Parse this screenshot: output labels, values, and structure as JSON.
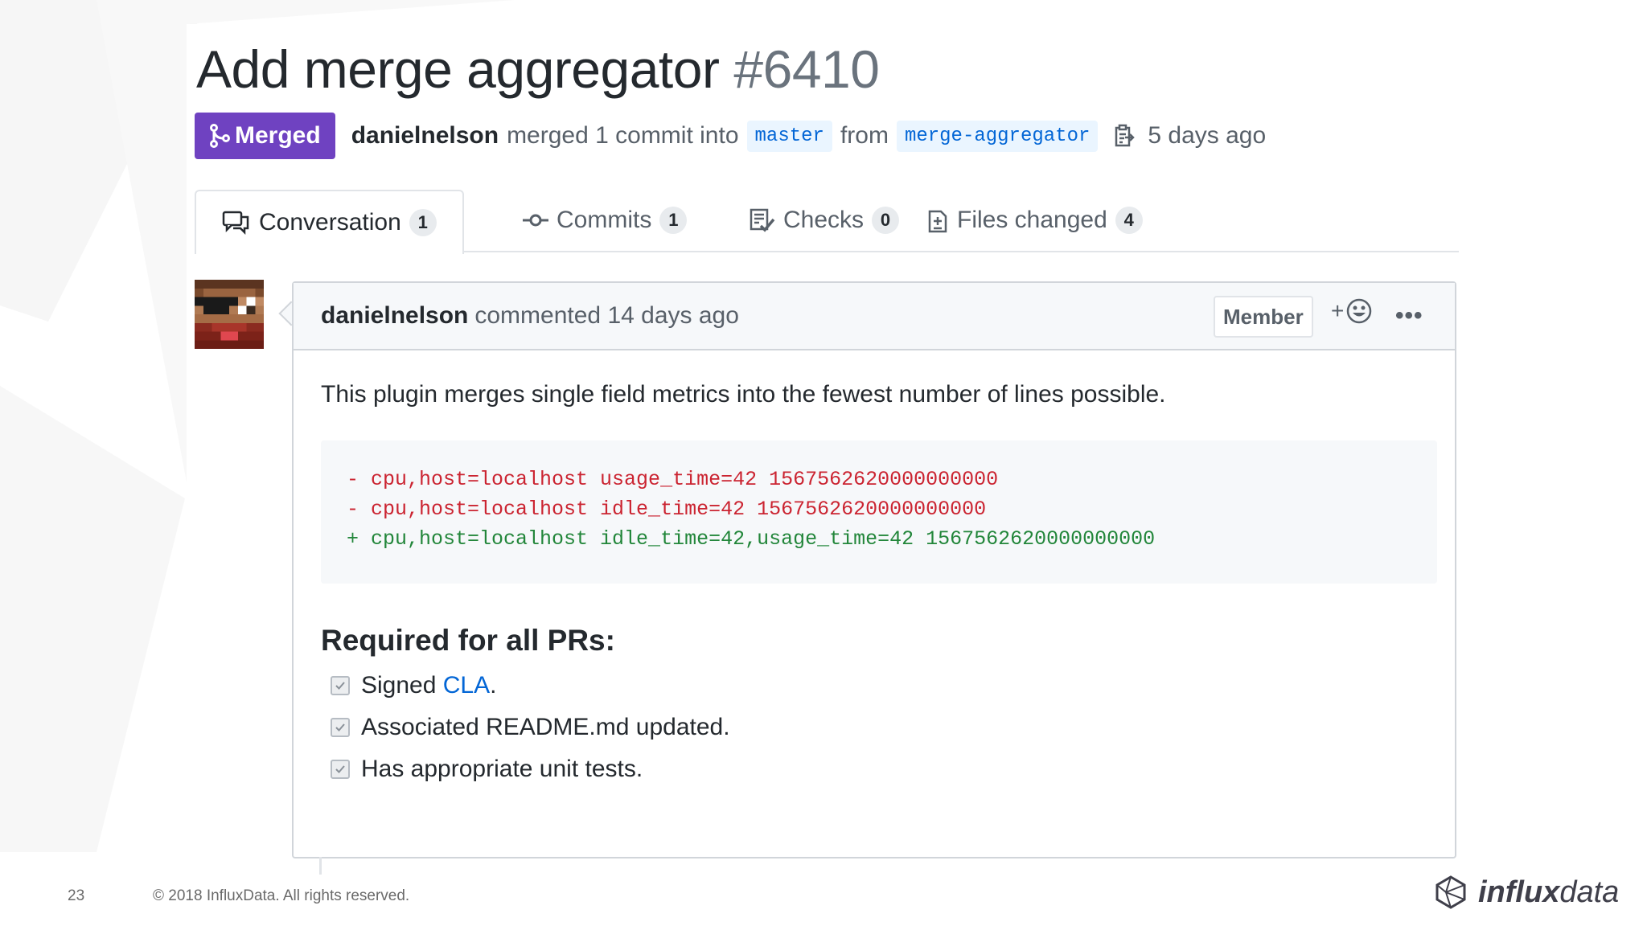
{
  "pr": {
    "title": "Add merge aggregator",
    "number": "#6410",
    "status": "Merged",
    "author": "danielnelson",
    "merge_text_1": "merged 1 commit into",
    "base_branch": "master",
    "merge_text_2": "from",
    "head_branch": "merge-aggregator",
    "time": "5 days ago"
  },
  "tabs": [
    {
      "label": "Conversation",
      "count": "1",
      "icon": "comment-discussion-icon"
    },
    {
      "label": "Commits",
      "count": "1",
      "icon": "git-commit-icon"
    },
    {
      "label": "Checks",
      "count": "0",
      "icon": "checklist-icon"
    },
    {
      "label": "Files changed",
      "count": "4",
      "icon": "file-diff-icon"
    }
  ],
  "comment": {
    "author": "danielnelson",
    "action": "commented 14 days ago",
    "role": "Member",
    "reaction": "+",
    "more": "•••",
    "body": "This plugin merges single field metrics into the fewest number of lines possible.",
    "diff": [
      "- cpu,host=localhost usage_time=42 1567562620000000000",
      "- cpu,host=localhost idle_time=42 1567562620000000000",
      "+ cpu,host=localhost idle_time=42,usage_time=42 1567562620000000000"
    ],
    "required_heading": "Required for all PRs:",
    "tasks": {
      "t1_prefix": "Signed ",
      "t1_link": "CLA",
      "t1_suffix": ".",
      "t2": "Associated README.md updated.",
      "t3": "Has appropriate unit tests."
    }
  },
  "footer": {
    "slide_number": "23",
    "copyright": "© 2018 InfluxData. All rights reserved.",
    "logo_bold": "influx",
    "logo_light": "data"
  },
  "colors": {
    "merged_purple": "#6f42c1",
    "link_blue": "#0366d6",
    "diff_red": "#cb2431",
    "diff_green": "#22863a"
  }
}
